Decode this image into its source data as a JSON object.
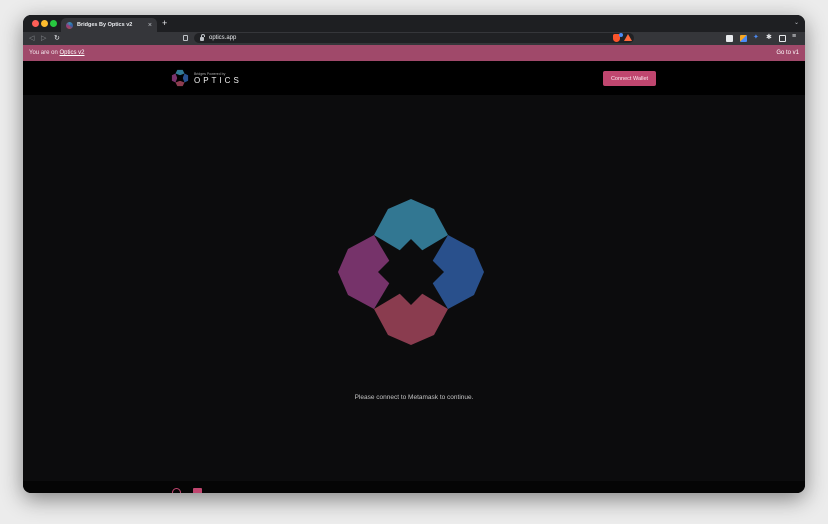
{
  "browser": {
    "tab_title": "Bridges By Optics v2",
    "tab_close": "×",
    "new_tab": "+",
    "url": "optics.app"
  },
  "banner": {
    "prefix": "You are on ",
    "link": "Optics v2",
    "right_link": "Go to v1"
  },
  "header": {
    "logo_subtitle": "Bridges Powered by",
    "logo_title": "OPTICS",
    "connect_button": "Connect Wallet"
  },
  "main": {
    "message": "Please connect to Metamask to continue."
  },
  "colors": {
    "accent": "#c0466f",
    "banner": "#a0496a",
    "teal": "#3a8fb0",
    "blue": "#2f5fa8",
    "rose": "#a6475e",
    "purple": "#8e3c7f"
  }
}
